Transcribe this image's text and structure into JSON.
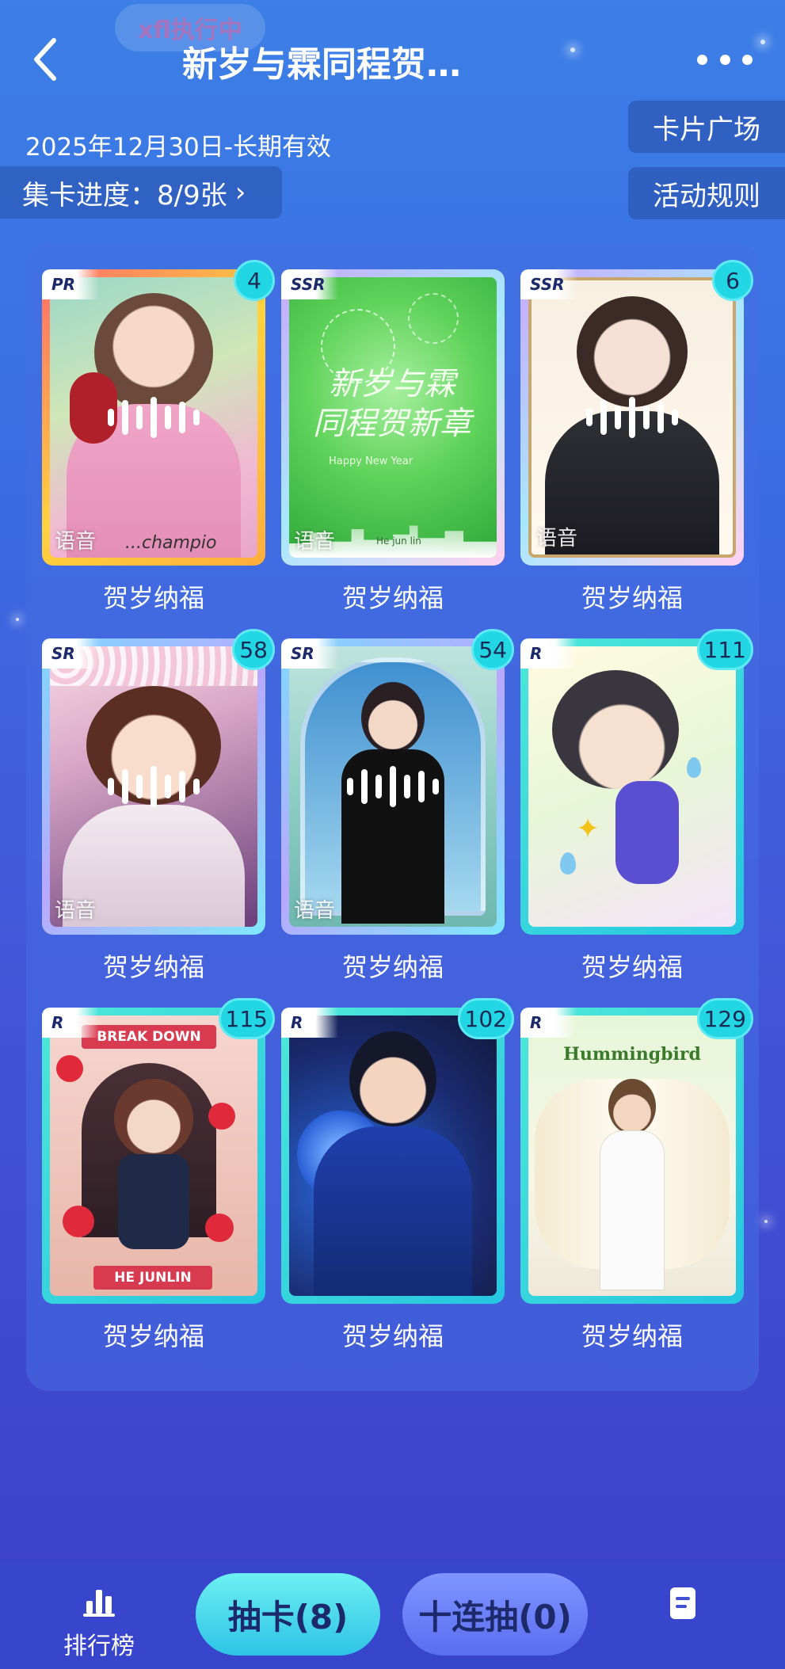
{
  "header": {
    "status_pill": "xfl执行中",
    "title": "新岁与霖同程贺…",
    "date_range": "2025年12月30日-长期有效",
    "progress_label": "集卡进度：8/9张",
    "card_square_label": "卡片广场",
    "rules_label": "活动规则"
  },
  "cards": [
    {
      "rarity": "PR",
      "count": "4",
      "label": "贺岁纳福",
      "voice": "语音",
      "signature": "...champio",
      "voice_wave": true
    },
    {
      "rarity": "SSR",
      "count": "",
      "label": "贺岁纳福",
      "voice": "语音",
      "card_text": "新岁与霖\n同程贺新章",
      "subtext": "Happy New Year",
      "signature": "He jun lin",
      "voice_wave": false
    },
    {
      "rarity": "SSR",
      "count": "6",
      "label": "贺岁纳福",
      "voice": "语音",
      "voice_wave": true
    },
    {
      "rarity": "SR",
      "count": "58",
      "label": "贺岁纳福",
      "voice": "语音",
      "voice_wave": true
    },
    {
      "rarity": "SR",
      "count": "54",
      "label": "贺岁纳福",
      "voice": "语音",
      "voice_wave": true
    },
    {
      "rarity": "R",
      "count": "111",
      "label": "贺岁纳福",
      "voice": "",
      "voice_wave": false
    },
    {
      "rarity": "R",
      "count": "115",
      "label": "贺岁纳福",
      "voice": "",
      "banner_top": "BREAK DOWN",
      "banner_bottom": "HE JUNLIN",
      "voice_wave": false
    },
    {
      "rarity": "R",
      "count": "102",
      "label": "贺岁纳福",
      "voice": "",
      "voice_wave": false
    },
    {
      "rarity": "R",
      "count": "129",
      "label": "贺岁纳福",
      "voice": "",
      "banner_top": "Hummingbird",
      "voice_wave": false
    }
  ],
  "bottom_bar": {
    "ranking_label": "排行榜",
    "draw_label": "抽卡(8)",
    "ten_draw_label": "十连抽(0)"
  },
  "icons": [
    "back-arrow-icon",
    "more-dots-icon",
    "chevron-right-icon",
    "voice-wave-icon",
    "bar-chart-icon",
    "document-icon"
  ],
  "colors": {
    "accent": "#22d6e3",
    "background": "#3f5ad9"
  }
}
